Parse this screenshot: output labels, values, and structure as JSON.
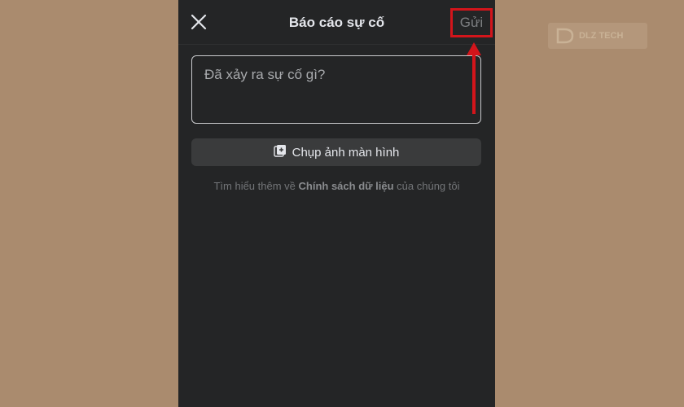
{
  "header": {
    "title": "Báo cáo sự cố",
    "send_label": "Gửi"
  },
  "report": {
    "placeholder": "Đã xảy ra sự cố gì?",
    "value": ""
  },
  "screenshot": {
    "label": "Chụp ảnh màn hình"
  },
  "policy": {
    "prefix": "Tìm hiểu thêm về ",
    "link": "Chính sách dữ liệu",
    "suffix": " của chúng tôi"
  },
  "watermark": {
    "text": "DLZ TECH"
  },
  "colors": {
    "background": "#aa8b6e",
    "panel": "#242526",
    "highlight": "#d3151b"
  },
  "icons": {
    "close": "close-icon",
    "screenshot": "screenshot-icon"
  }
}
